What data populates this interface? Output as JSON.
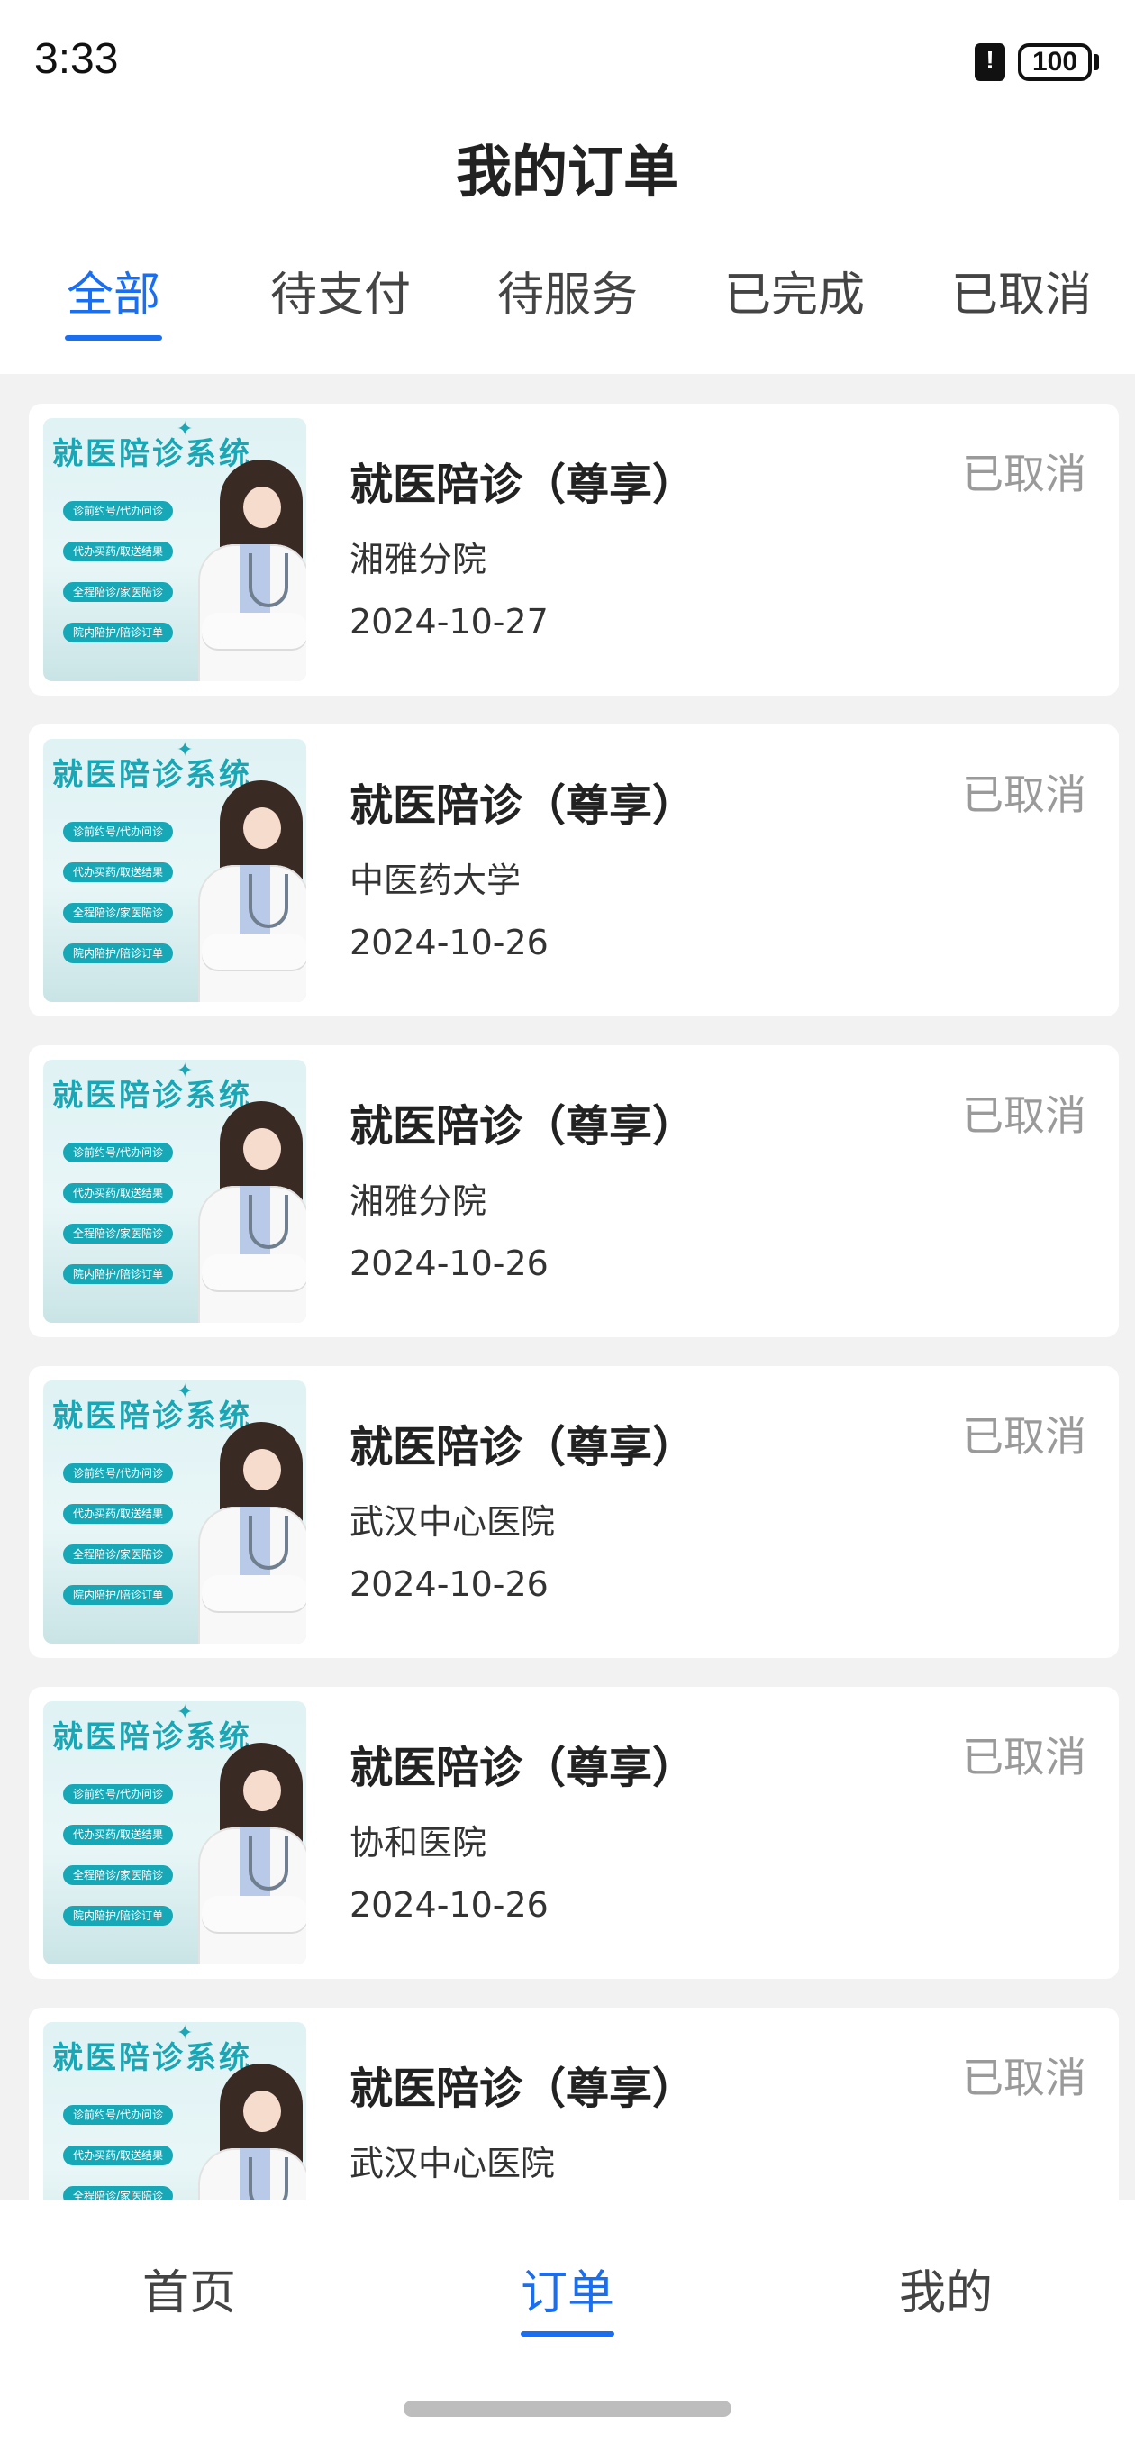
{
  "status_bar": {
    "time": "3:33",
    "battery": "100"
  },
  "header": {
    "title": "我的订单"
  },
  "tabs": [
    {
      "label": "全部",
      "active": true
    },
    {
      "label": "待支付",
      "active": false
    },
    {
      "label": "待服务",
      "active": false
    },
    {
      "label": "已完成",
      "active": false
    },
    {
      "label": "已取消",
      "active": false
    }
  ],
  "thumbnail": {
    "title": "就医陪诊系统",
    "pills": [
      "诊前约号/代办问诊",
      "代办买药/取送结果",
      "全程陪诊/家医陪诊",
      "院内陪护/陪诊订单"
    ]
  },
  "orders": [
    {
      "service": "就医陪诊（尊享）",
      "hospital": "湘雅分院",
      "date": "2024-10-27",
      "status": "已取消"
    },
    {
      "service": "就医陪诊（尊享）",
      "hospital": "中医药大学",
      "date": "2024-10-26",
      "status": "已取消"
    },
    {
      "service": "就医陪诊（尊享）",
      "hospital": "湘雅分院",
      "date": "2024-10-26",
      "status": "已取消"
    },
    {
      "service": "就医陪诊（尊享）",
      "hospital": "武汉中心医院",
      "date": "2024-10-26",
      "status": "已取消"
    },
    {
      "service": "就医陪诊（尊享）",
      "hospital": "协和医院",
      "date": "2024-10-26",
      "status": "已取消"
    },
    {
      "service": "就医陪诊（尊享）",
      "hospital": "武汉中心医院",
      "date": "",
      "status": "已取消"
    }
  ],
  "bottom_nav": [
    {
      "label": "首页",
      "active": false
    },
    {
      "label": "订单",
      "active": true
    },
    {
      "label": "我的",
      "active": false
    }
  ],
  "colors": {
    "accent": "#1a6ef0",
    "status_gray": "#9a9a9a",
    "thumb_teal": "#17a8b8"
  }
}
